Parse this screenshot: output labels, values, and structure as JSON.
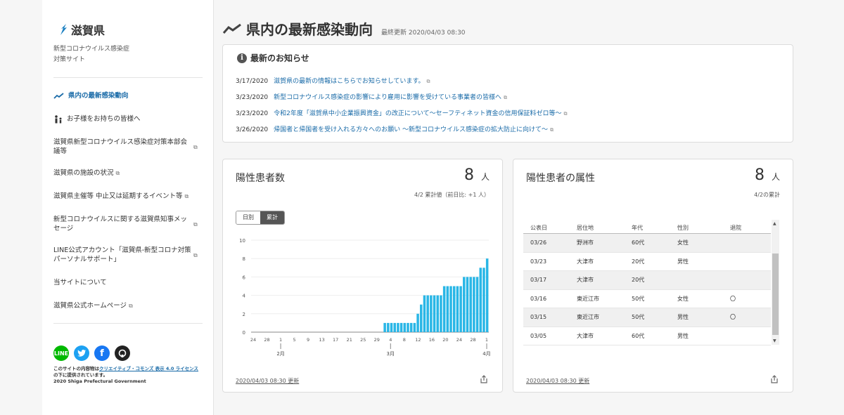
{
  "sidebar": {
    "logo": "滋賀県",
    "subtitle_line1": "新型コロナウイルス感染症",
    "subtitle_line2": "対策サイト",
    "items": [
      {
        "label": "県内の最新感染動向",
        "active": true,
        "icon": "trend-icon"
      },
      {
        "label": "お子様をお持ちの皆様へ",
        "icon": "parent-child-icon"
      },
      {
        "label": "滋賀県新型コロナウイルス感染症対策本部会議等",
        "external": true
      },
      {
        "label": "滋賀県の施設の状況",
        "external": true
      },
      {
        "label": "滋賀県主催等 中止又は延期するイベント等",
        "external": true
      },
      {
        "label": "新型コロナウイルスに関する滋賀県知事メッセージ",
        "external": true
      },
      {
        "label": "LINE公式アカウント「滋賀県-新型コロナ対策パーソナルサポート」",
        "external": true
      },
      {
        "label": "当サイトについて"
      },
      {
        "label": "滋賀県公式ホームページ",
        "external": true
      }
    ],
    "social": [
      "line-icon",
      "twitter-icon",
      "facebook-icon",
      "github-icon"
    ],
    "license_prefix": "このサイトの内容物は",
    "license_link": "クリエイティブ・コモンズ 表示 4.0 ライセンス",
    "license_suffix": "の下に提供されています。",
    "copyright": "2020 Shiga Prefectural Government"
  },
  "header": {
    "title": "県内の最新感染動向",
    "updated": "最終更新 2020/04/03 08:30"
  },
  "news": {
    "title": "最新のお知らせ",
    "items": [
      {
        "date": "3/17/2020",
        "text": "滋賀県の最新の情報はこちらでお知らせしています。"
      },
      {
        "date": "3/23/2020",
        "text": "新型コロナウイルス感染症の影響により雇用に影響を受けている事業者の皆様へ"
      },
      {
        "date": "3/23/2020",
        "text": "令和2年度「滋賀県中小企業振興資金」の改正について～セーフティネット資金の信用保証料ゼロ等～"
      },
      {
        "date": "3/26/2020",
        "text": "帰国者と帰国者を受け入れる方々へのお願い ～新型コロナウイルス感染症の拡大防止に向けて～"
      }
    ]
  },
  "positives": {
    "title": "陽性患者数",
    "value": "8",
    "unit": "人",
    "note": "4/2 累計値（前日比: +1 人）",
    "toggle_daily": "日別",
    "toggle_cumulative": "累計",
    "footer": "2020/04/03 08:30 更新"
  },
  "attributes": {
    "title": "陽性患者の属性",
    "value": "8",
    "unit": "人",
    "note": "4/2の累計",
    "columns": [
      "公表日",
      "居住地",
      "年代",
      "性別",
      "退院"
    ],
    "rows": [
      [
        "03/26",
        "野洲市",
        "60代",
        "女性",
        ""
      ],
      [
        "03/23",
        "大津市",
        "20代",
        "男性",
        ""
      ],
      [
        "03/17",
        "大津市",
        "20代",
        "",
        ""
      ],
      [
        "03/16",
        "東近江市",
        "50代",
        "女性",
        "〇"
      ],
      [
        "03/15",
        "東近江市",
        "50代",
        "男性",
        "〇"
      ],
      [
        "03/05",
        "大津市",
        "60代",
        "男性",
        ""
      ]
    ],
    "footer": "2020/04/03 08:30 更新"
  },
  "chart_data": {
    "type": "bar",
    "title": "陽性患者数",
    "ylim": [
      0,
      10
    ],
    "yticks": [
      0,
      2,
      4,
      6,
      8,
      10
    ],
    "tick_labels": [
      "24",
      "28",
      "1",
      "5",
      "9",
      "13",
      "17",
      "21",
      "25",
      "29",
      "4",
      "8",
      "12",
      "16",
      "20",
      "24",
      "28",
      "1"
    ],
    "month_labels": [
      "2月",
      "3月",
      "4月"
    ],
    "values": [
      0,
      0,
      0,
      0,
      0,
      0,
      0,
      0,
      0,
      0,
      0,
      0,
      0,
      0,
      0,
      0,
      0,
      0,
      0,
      0,
      0,
      0,
      0,
      0,
      0,
      0,
      0,
      0,
      0,
      0,
      0,
      0,
      0,
      0,
      0,
      0,
      0,
      0,
      0,
      0,
      1,
      1,
      1,
      1,
      1,
      1,
      1,
      1,
      1,
      1,
      2,
      3,
      4,
      4,
      4,
      4,
      4,
      4,
      5,
      5,
      5,
      5,
      5,
      5,
      6,
      6,
      6,
      6,
      6,
      7,
      7,
      8
    ],
    "color": "#29b6e6"
  }
}
